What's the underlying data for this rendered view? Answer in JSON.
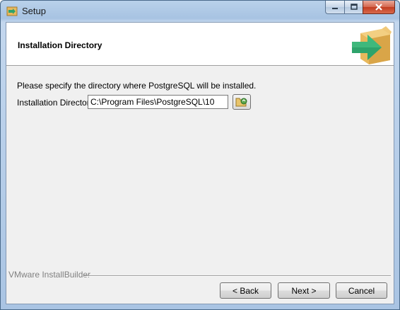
{
  "window": {
    "title": "Setup",
    "icon": "setup-app-icon",
    "caption_buttons": [
      "minimize-icon",
      "maximize-icon",
      "close-icon"
    ]
  },
  "header": {
    "title": "Installation Directory",
    "graphic": "box-arrow-icon"
  },
  "body": {
    "instruction": "Please specify the directory where PostgreSQL will be installed.",
    "directory_label": "Installation Directory",
    "directory_value": "C:\\Program Files\\PostgreSQL\\10",
    "browse_icon": "folder-browse-icon"
  },
  "footer": {
    "brand": "VMware InstallBuilder",
    "back_label": "< Back",
    "next_label": "Next >",
    "cancel_label": "Cancel"
  },
  "colors": {
    "accent_green": "#2ea36b",
    "box_tan": "#e8b85c"
  }
}
